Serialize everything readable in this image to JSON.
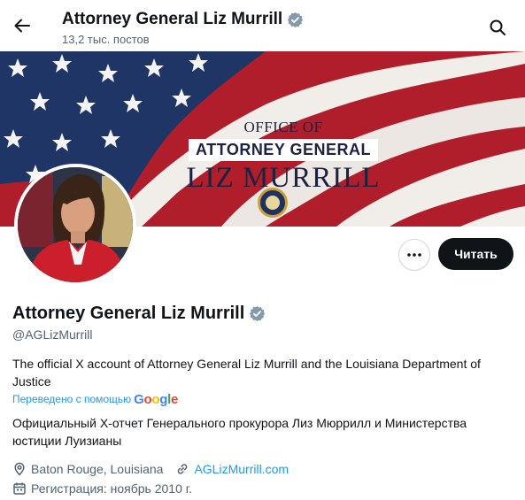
{
  "header": {
    "back_icon": "arrow-left-icon",
    "title": "Attorney General Liz Murrill",
    "posts_count": "13,2 тыс. постов",
    "search_icon": "search-icon"
  },
  "banner": {
    "line1": "OFFICE OF",
    "line2": "ATTORNEY GENERAL",
    "line3": "LIZ MURRILL"
  },
  "actions": {
    "more_icon": "more-dots-icon",
    "follow_label": "Читать"
  },
  "profile": {
    "name": "Attorney General Liz Murrill",
    "handle": "@AGLizMurrill",
    "bio": "The official X account of Attorney General Liz Murrill and the Louisiana Department of Justice",
    "translated_label": "Переведено с помощью",
    "translated_brand": "Google",
    "bio_translation": "Официальный X-отчет Генерального прокурора Лиз Мюррилл и Министерства юстиции Луизианы",
    "location": "Baton Rouge, Louisiana",
    "website": "AGLizMurrill.com",
    "joined": "Регистрация: ноябрь 2010 г."
  },
  "colors": {
    "verified_badge": "#829aab",
    "link": "#1d9bf0",
    "follow_button": "#0f1419",
    "flag_red": "#b01d2b",
    "flag_blue": "#1f3566",
    "google_blue": "#4285f4",
    "google_red": "#ea4335",
    "google_yellow": "#fbbc05",
    "google_green": "#34a853"
  }
}
